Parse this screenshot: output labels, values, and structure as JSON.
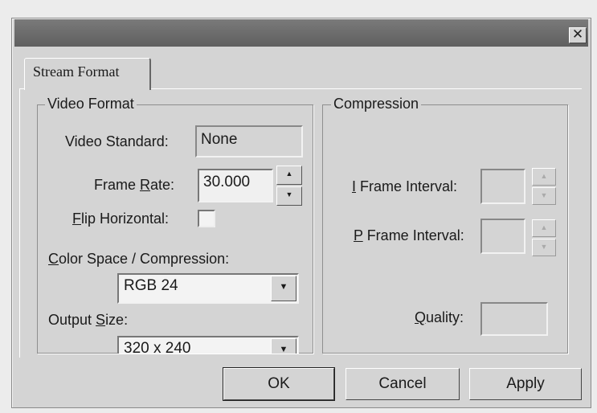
{
  "window": {
    "close_glyph": "✕"
  },
  "tabs": [
    {
      "label": "Stream Format"
    }
  ],
  "video_format": {
    "title": "Video Format",
    "video_standard": {
      "label": "Video Standard:",
      "value": "None"
    },
    "frame_rate": {
      "label_pre": "Frame ",
      "label_key": "R",
      "label_post": "ate:",
      "value": "30.000"
    },
    "flip_horizontal": {
      "label_key": "F",
      "label_post": "lip Horizontal:",
      "checked": false
    },
    "color_space": {
      "label_key": "C",
      "label_post": "olor Space / Compression:",
      "value": "RGB 24"
    },
    "output_size": {
      "label_pre": "Output ",
      "label_key": "S",
      "label_post": "ize:",
      "value": "320 x 240"
    }
  },
  "compression": {
    "title": "Compression",
    "i_frame": {
      "label_key": "I",
      "label_post": " Frame Interval:"
    },
    "p_frame": {
      "label_key": "P",
      "label_post": " Frame Interval:"
    },
    "quality": {
      "label_key": "Q",
      "label_post": "uality:"
    }
  },
  "buttons": {
    "ok": "OK",
    "cancel": "Cancel",
    "apply": "Apply"
  },
  "icons": {
    "spin_up": "▲",
    "spin_down": "▼",
    "dropdown": "▼"
  }
}
